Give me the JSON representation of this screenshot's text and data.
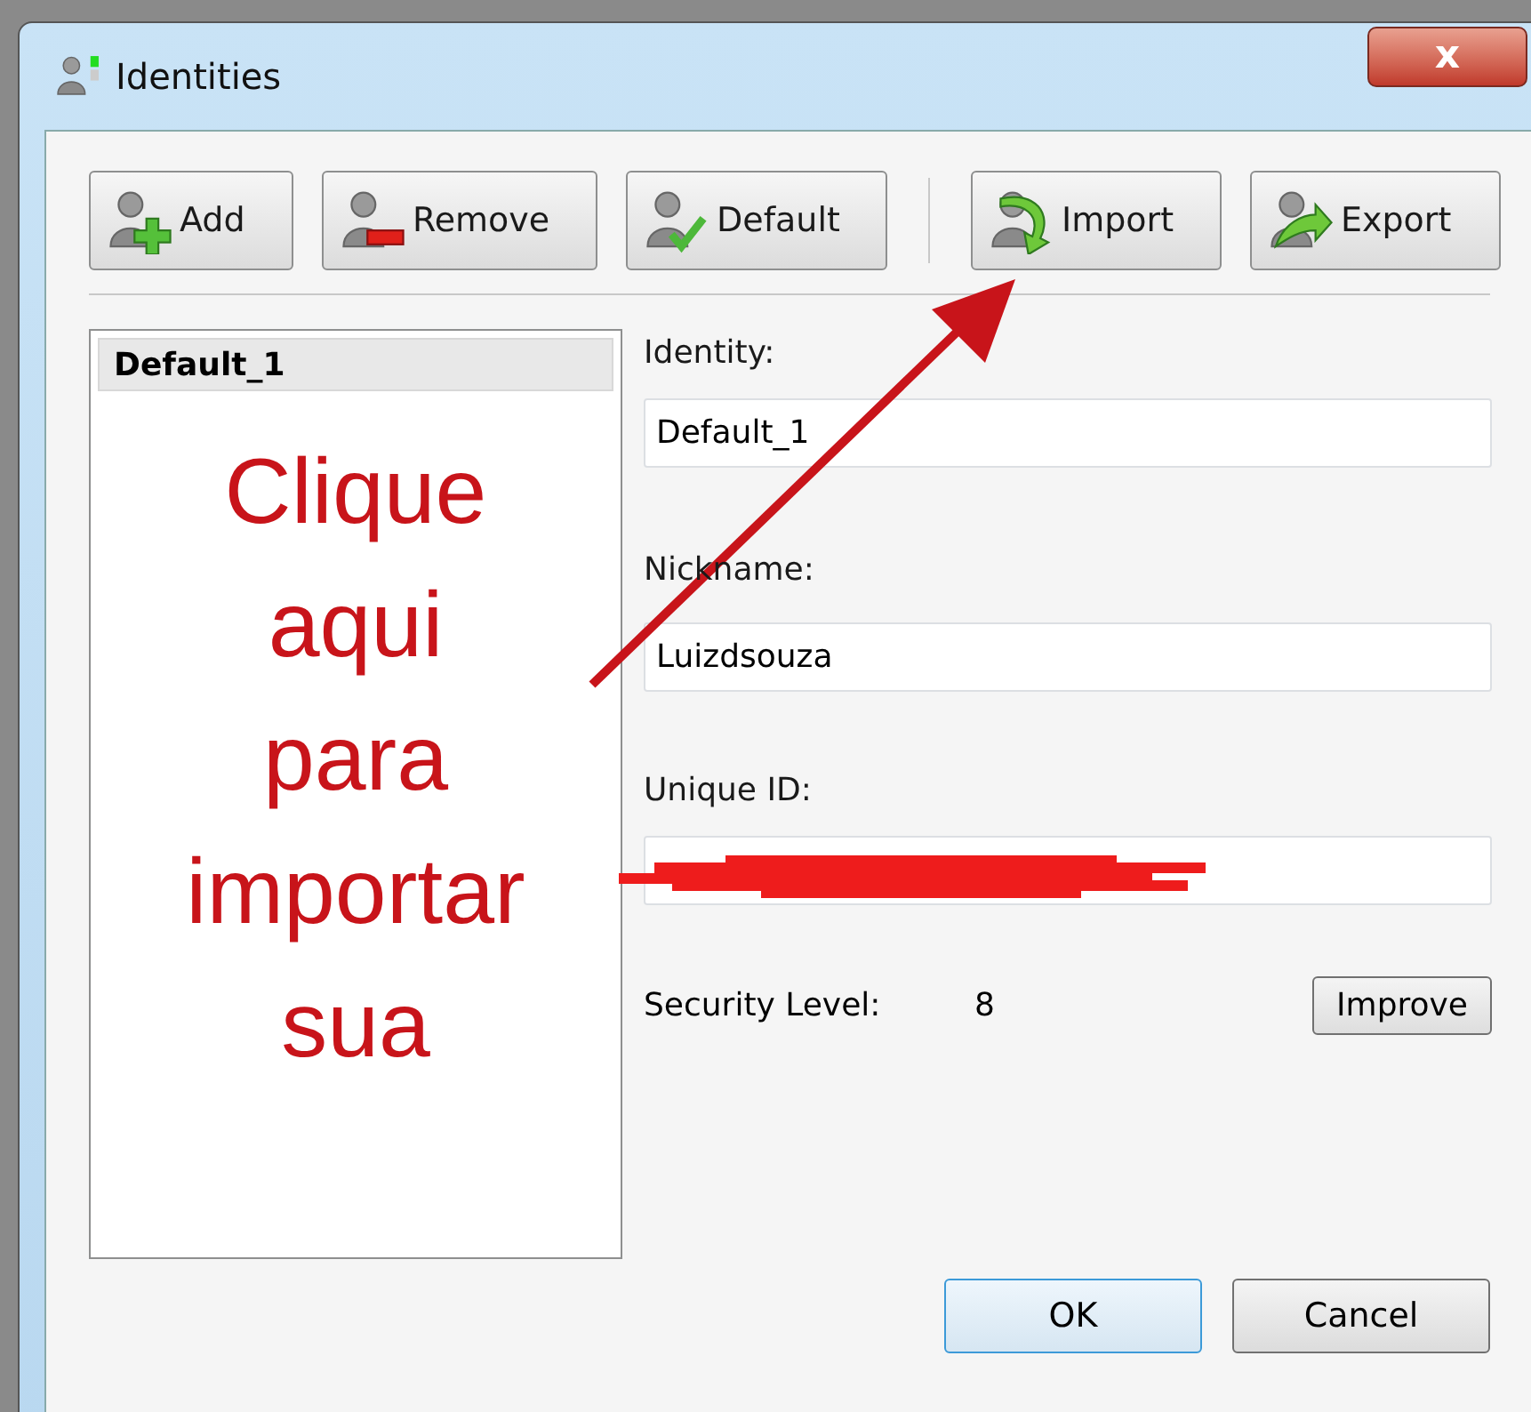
{
  "window": {
    "title": "Identities",
    "close_label": "x"
  },
  "toolbar": [
    {
      "kind": "add",
      "label": "Add"
    },
    {
      "kind": "remove",
      "label": "Remove"
    },
    {
      "kind": "default",
      "label": "Default"
    },
    {
      "kind": "import",
      "label": "Import"
    },
    {
      "kind": "export",
      "label": "Export"
    }
  ],
  "identity_list": [
    {
      "label": "Default_1",
      "selected": true
    }
  ],
  "form": {
    "identity_label": "Identity:",
    "identity": "Default_1",
    "nickname_label": "Nickname:",
    "nickname": "Luizdsouza",
    "unique_id_label": "Unique ID:",
    "security_label": "Security Level:",
    "security_value": "8",
    "improve": "Improve"
  },
  "annotation": {
    "text": "Clique aqui para importar sua"
  },
  "buttons": [
    "OK",
    "Cancel"
  ]
}
